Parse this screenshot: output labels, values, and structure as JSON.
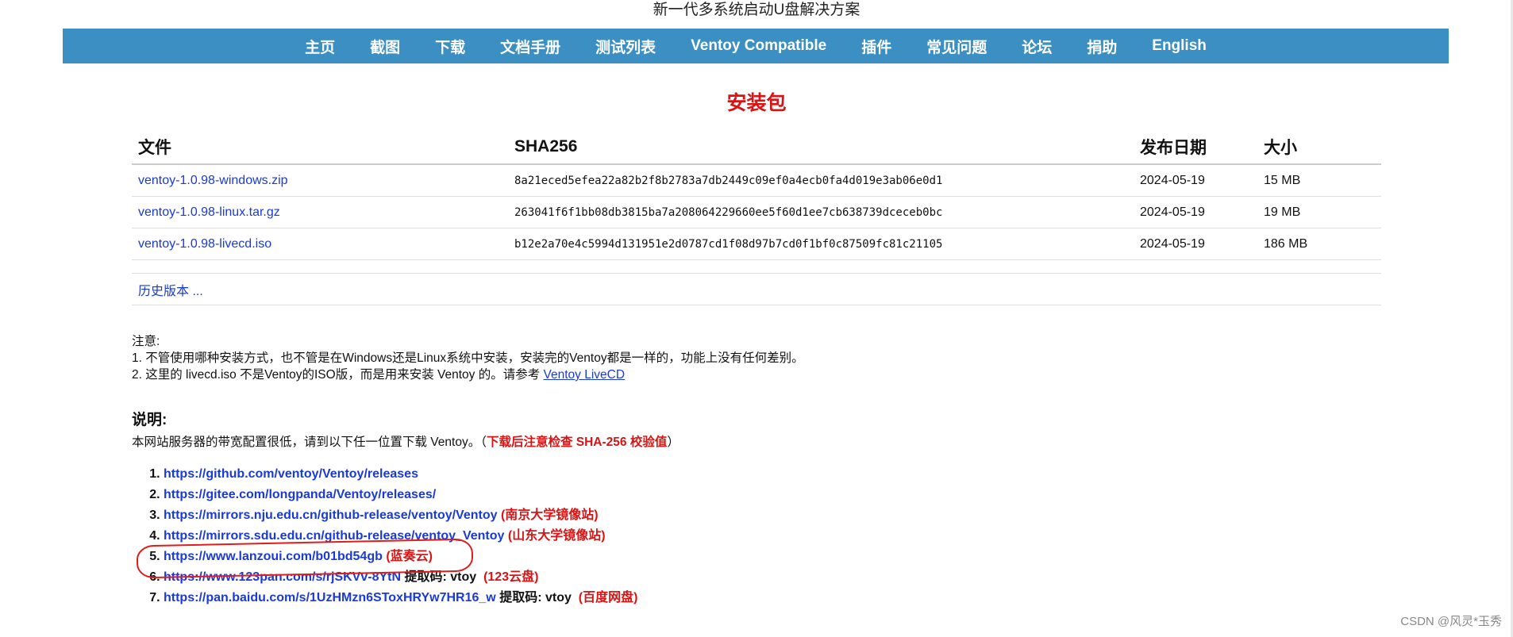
{
  "header": {
    "subtitle": "新一代多系统启动U盘解决方案"
  },
  "nav": {
    "items": [
      "主页",
      "截图",
      "下载",
      "文档手册",
      "测试列表",
      "Ventoy Compatible",
      "插件",
      "常见问题",
      "论坛",
      "捐助",
      "English"
    ],
    "bg_color": "#3b8fc2"
  },
  "page": {
    "title": "安装包",
    "title_color": "#d81414"
  },
  "table": {
    "headers": [
      "文件",
      "SHA256",
      "发布日期",
      "大小"
    ],
    "rows": [
      [
        "ventoy-1.0.98-windows.zip",
        "8a21eced5efea22a82b2f8b2783a7db2449c09ef0a4ecb0fa4d019e3ab06e0d1",
        "2024-05-19",
        "15 MB"
      ],
      [
        "ventoy-1.0.98-linux.tar.gz",
        "263041f6f1bb08db3815ba7a208064229660ee5f60d1ee7cb638739dceceb0bc",
        "2024-05-19",
        "19 MB"
      ],
      [
        "ventoy-1.0.98-livecd.iso",
        "b12e2a70e4c5994d131951e2d0787cd1f08d97b7cd0f1bf0c87509fc81c21105",
        "2024-05-19",
        "186 MB"
      ]
    ],
    "history_link": "历史版本 ..."
  },
  "notes": {
    "label": "注意:",
    "line1": "1. 不管使用哪种安装方式，也不管是在Windows还是Linux系统中安装，安装完的Ventoy都是一样的，功能上没有任何差别。",
    "line2_prefix": "2. 这里的 livecd.iso 不是Ventoy的ISO版，而是用来安装 Ventoy 的。请参考 ",
    "line2_link": "Ventoy LiveCD"
  },
  "description": {
    "heading": "说明:",
    "text_prefix": "本网站服务器的带宽配置很低，请到以下任一位置下载 Ventoy。（",
    "text_warning": "下载后注意检查 SHA-256 校验值",
    "text_suffix": "）"
  },
  "mirrors": [
    {
      "url": "https://github.com/ventoy/Ventoy/releases",
      "code": "",
      "tag": ""
    },
    {
      "url": "https://gitee.com/longpanda/Ventoy/releases/",
      "code": "",
      "tag": ""
    },
    {
      "url": "https://mirrors.nju.edu.cn/github-release/ventoy/Ventoy",
      "code": "",
      "tag": "(南京大学镜像站)"
    },
    {
      "url": "https://mirrors.sdu.edu.cn/github-release/ventoy_Ventoy",
      "code": "",
      "tag": "(山东大学镜像站)"
    },
    {
      "url": "https://www.lanzoui.com/b01bd54gb",
      "code": "",
      "tag": "(蓝奏云)"
    },
    {
      "url": "https://www.123pan.com/s/rjSKVv-8YtN",
      "code": "提取码: vtoy",
      "tag": "(123云盘)"
    },
    {
      "url": "https://pan.baidu.com/s/1UzHMzn6SToxHRYw7HR16_w",
      "code": "提取码: vtoy",
      "tag": "(百度网盘)"
    }
  ],
  "watermark": "CSDN @风灵*玉秀"
}
